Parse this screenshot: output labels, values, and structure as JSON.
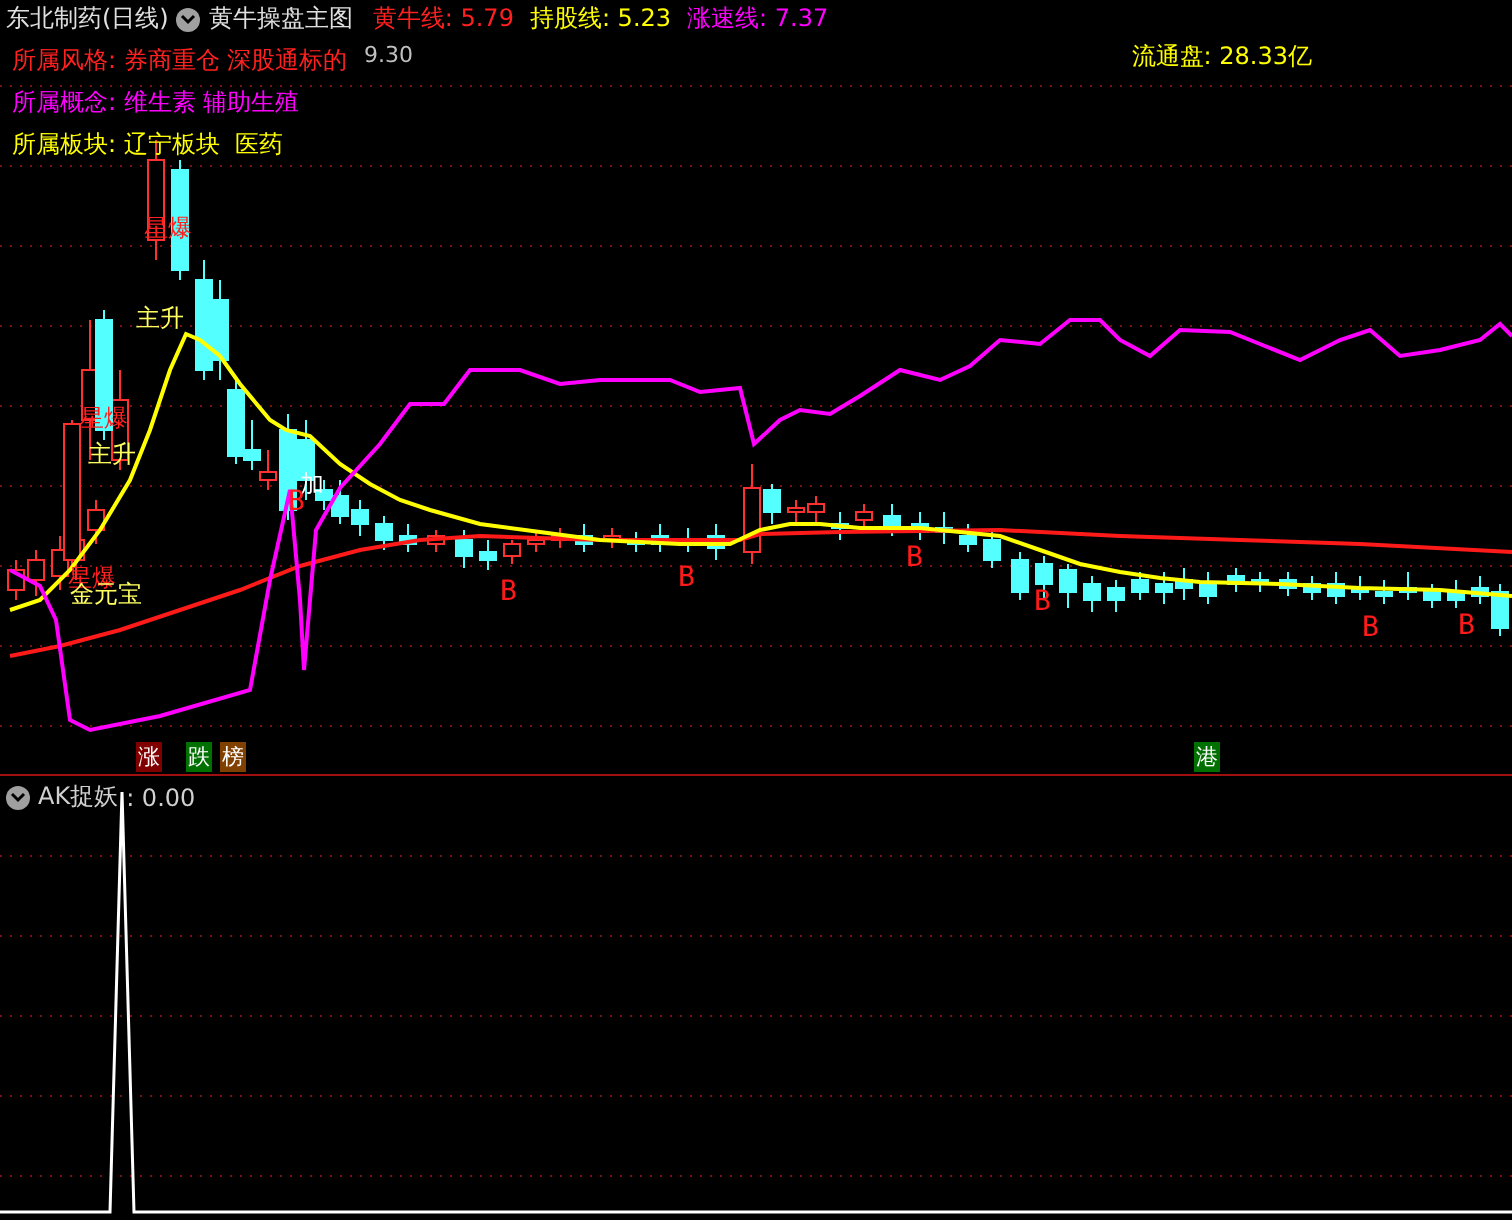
{
  "header": {
    "stock": "东北制药(日线)",
    "indicator": "黄牛操盘主图",
    "readings": [
      {
        "label": "黄牛线:",
        "value": "5.79",
        "color": "#ff2020"
      },
      {
        "label": "持股线:",
        "value": "5.23",
        "color": "#ffff00"
      },
      {
        "label": "涨速线:",
        "value": "7.37",
        "color": "#ff00ff"
      }
    ]
  },
  "info": [
    {
      "label": "所属风格:",
      "value": "券商重仓 深股通标的",
      "color": "#ff2020"
    },
    {
      "label": "所属概念:",
      "value": "维生素 辅助生殖",
      "color": "#ff00ff"
    },
    {
      "label": "所属板块:",
      "value": "辽宁板块  医药",
      "color": "#ffff00"
    }
  ],
  "float_cap": {
    "label": "流通盘:",
    "value": "28.33亿"
  },
  "chart_marks": [
    {
      "text": "9.30",
      "kind": "price"
    },
    {
      "text": "星爆",
      "kind": "signal"
    },
    {
      "text": "主升",
      "kind": "trend"
    },
    {
      "text": "星爆",
      "kind": "signal"
    },
    {
      "text": "主升",
      "kind": "trend"
    },
    {
      "text": "星爆",
      "kind": "signal"
    },
    {
      "text": "金元宝",
      "kind": "trend"
    },
    {
      "text": "加",
      "kind": "add"
    },
    {
      "text": "B",
      "kind": "buy"
    },
    {
      "text": "B",
      "kind": "buy"
    },
    {
      "text": "B",
      "kind": "buy"
    },
    {
      "text": "B",
      "kind": "buy"
    },
    {
      "text": "B",
      "kind": "buy"
    },
    {
      "text": "B",
      "kind": "buy"
    },
    {
      "text": "B",
      "kind": "buy"
    }
  ],
  "badges": [
    {
      "text": "涨",
      "color": "#800000"
    },
    {
      "text": "跌",
      "color": "#007000"
    },
    {
      "text": "榜",
      "color": "#804000"
    },
    {
      "text": "港",
      "color": "#007000"
    }
  ],
  "sub_panel": {
    "name": "AK捉妖",
    "value": ": 0.00"
  }
}
